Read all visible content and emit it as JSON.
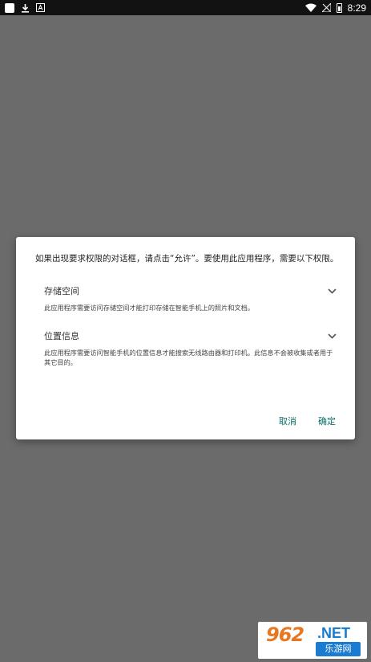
{
  "status_bar": {
    "time": "8:29",
    "icons_left": [
      "app-icon",
      "download-icon",
      "font-icon"
    ],
    "icons_right": [
      "wifi-icon",
      "no-signal-icon",
      "battery-icon"
    ]
  },
  "dialog": {
    "title": "如果出现要求权限的对话框，请点击“允许”。要使用此应用程序，需要以下权限。",
    "sections": [
      {
        "title": "存储空间",
        "desc": "此应用程序需要访问存储空间才能打印存储在智能手机上的照片和文档。"
      },
      {
        "title": "位置信息",
        "desc": "此应用程序需要访问智能手机的位置信息才能搜索无线路由器和打印机。此信息不会被收集或者用于其它目的。"
      }
    ],
    "cancel_label": "取消",
    "ok_label": "确定"
  },
  "watermark": {
    "number": "962",
    "suffix": ".NET",
    "cn": "乐游网"
  },
  "colors": {
    "overlay": "#6b6b6b",
    "status_bar": "#121212",
    "accent": "#0b6f6a"
  }
}
